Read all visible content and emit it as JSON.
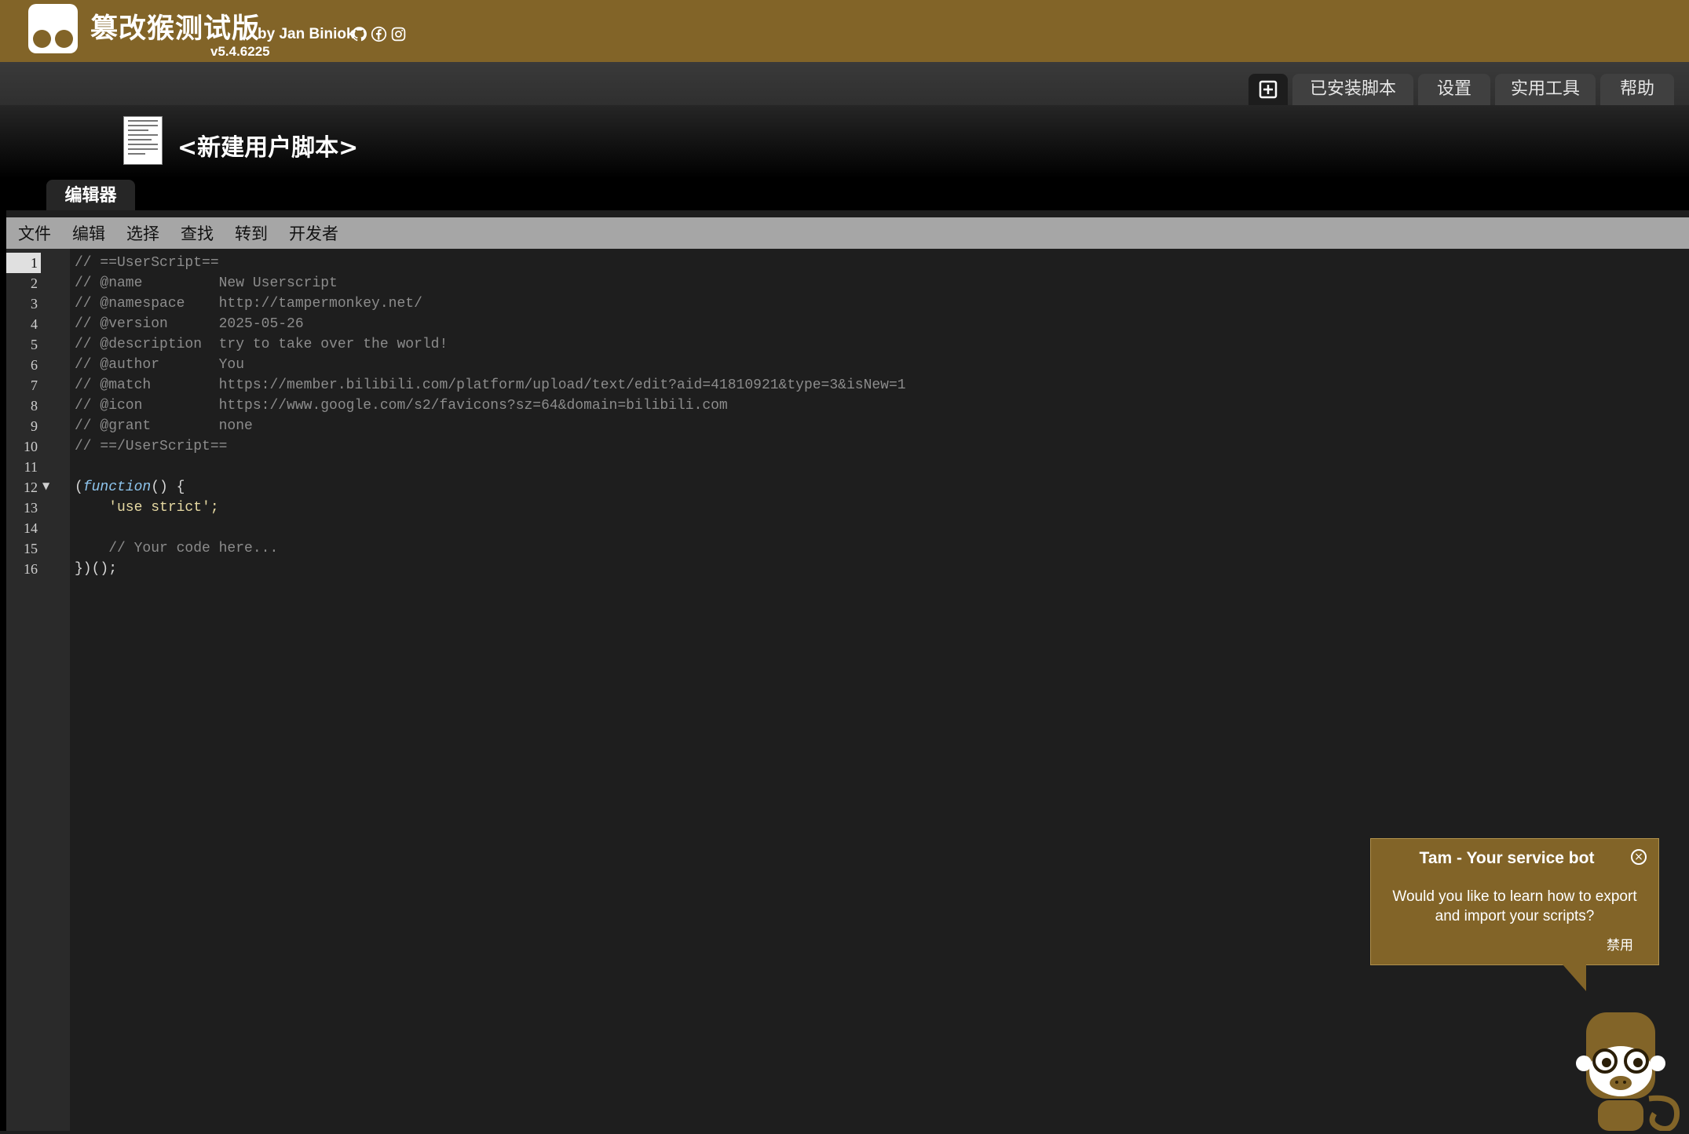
{
  "header": {
    "app_title": "篡改猴测试版",
    "byline": "by Jan Biniok",
    "version": "v5.4.6225",
    "social_icons": [
      "github-icon",
      "facebook-icon",
      "instagram-icon"
    ]
  },
  "nav": {
    "new_script_icon": "plus-square-icon",
    "tabs": [
      "已安装脚本",
      "设置",
      "实用工具",
      "帮助"
    ]
  },
  "script": {
    "title": "<新建用户脚本>",
    "editor_tab": "编辑器"
  },
  "menu": [
    "文件",
    "编辑",
    "选择",
    "查找",
    "转到",
    "开发者"
  ],
  "editor": {
    "active_line": 1,
    "lines": [
      "// ==UserScript==",
      "// @name         New Userscript",
      "// @namespace    http://tampermonkey.net/",
      "// @version      2025-05-26",
      "// @description  try to take over the world!",
      "// @author       You",
      "// @match        https://member.bilibili.com/platform/upload/text/edit?aid=41810921&type=3&isNew=1",
      "// @icon         https://www.google.com/s2/favicons?sz=64&domain=bilibili.com",
      "// @grant        none",
      "// ==/UserScript==",
      "",
      "(function() {",
      "    'use strict';",
      "",
      "    // Your code here...",
      "})();"
    ]
  },
  "bot": {
    "title": "Tam - Your service bot",
    "message": "Would you like to learn how to export and import your scripts?",
    "disable_label": "禁用",
    "close_icon": "close-circle-icon"
  },
  "colors": {
    "brand": "#826428",
    "background": "#1e1e1e",
    "menubar": "#a6a6a6"
  }
}
